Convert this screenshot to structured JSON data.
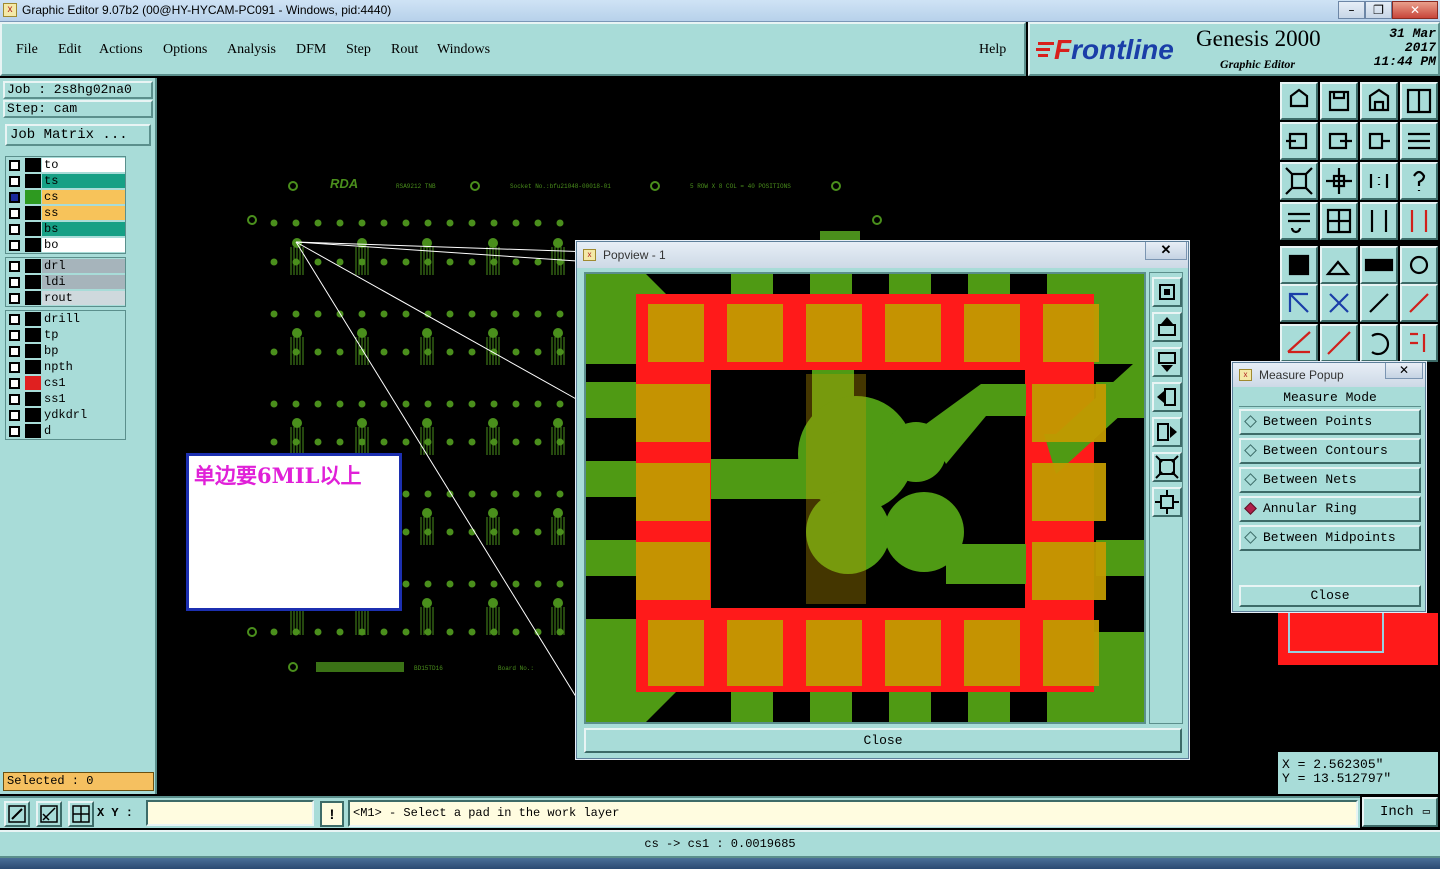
{
  "window": {
    "title": "Graphic Editor 9.07b2 (00@HY-HYCAM-PC091 - Windows, pid:4440)",
    "min": "–",
    "max": "❐",
    "close": "✕",
    "app_icon": "x"
  },
  "menu": [
    {
      "label": "File"
    },
    {
      "label": "Edit"
    },
    {
      "label": "Actions"
    },
    {
      "label": "Options"
    },
    {
      "label": "Analysis"
    },
    {
      "label": "DFM"
    },
    {
      "label": "Step"
    },
    {
      "label": "Rout"
    },
    {
      "label": "Windows"
    }
  ],
  "help": "Help",
  "banner": {
    "brand_f": "F",
    "brand_rest": "rontline",
    "product": "Genesis 2000",
    "subtitle": "Graphic Editor",
    "date": "31 Mar 2017",
    "time": "11:44 PM"
  },
  "job": {
    "job_line": "Job : 2s8hg02na0",
    "step_line": "Step: cam",
    "matrix_button": "Job Matrix ..."
  },
  "layers": {
    "group1": [
      {
        "name": "to",
        "color": "#ffffff",
        "checked": false
      },
      {
        "name": "ts",
        "color": "#16a085",
        "checked": false
      },
      {
        "name": "cs",
        "color": "#f7c35a",
        "checked": true,
        "swatch": "#2e9a20"
      },
      {
        "name": "ss",
        "color": "#f7c35a",
        "checked": false
      },
      {
        "name": "bs",
        "color": "#16a085",
        "checked": false
      },
      {
        "name": "bo",
        "color": "#ffffff",
        "checked": false
      }
    ],
    "group2": [
      {
        "name": "drl",
        "color": "#a6b4bb",
        "checked": false
      },
      {
        "name": "ldi",
        "color": "#a6b4bb",
        "checked": false
      },
      {
        "name": "rout",
        "color": "#cfd9dd",
        "checked": false
      }
    ],
    "group3": [
      {
        "name": "drill",
        "color": "#a8dcd8",
        "checked": false
      },
      {
        "name": "tp",
        "color": "#a8dcd8",
        "checked": false
      },
      {
        "name": "bp",
        "color": "#a8dcd8",
        "checked": false
      },
      {
        "name": "npth",
        "color": "#a8dcd8",
        "checked": false
      },
      {
        "name": "cs1",
        "color": "#a8dcd8",
        "checked": false,
        "swatch": "#e02020"
      },
      {
        "name": "ss1",
        "color": "#a8dcd8",
        "checked": false
      },
      {
        "name": "ydkdrl",
        "color": "#a8dcd8",
        "checked": false
      },
      {
        "name": "d",
        "color": "#a8dcd8",
        "checked": false
      }
    ]
  },
  "selected_text": "Selected : 0",
  "annotation": "单边要6MIL以上",
  "board_texts": {
    "logo": "RDA",
    "t1": "RSA9212 TNB",
    "t2": "Socket No.:bfu21048-00018-01",
    "t3": "5 ROW X 8 COL = 40 POSITIONS",
    "t4": "BD15TD16",
    "t5": "Board No.:"
  },
  "popview": {
    "title": "Popview - 1",
    "close_x": "✕",
    "close_button": "Close"
  },
  "measure": {
    "title": "Measure Popup",
    "close_x": "✕",
    "mode_label": "Measure Mode",
    "options": [
      {
        "label": "Between Points",
        "selected": false
      },
      {
        "label": "Between Contours",
        "selected": false
      },
      {
        "label": "Between Nets",
        "selected": false
      },
      {
        "label": "Annular Ring",
        "selected": true
      },
      {
        "label": "Between Midpoints",
        "selected": false
      }
    ],
    "close_button": "Close"
  },
  "coords": {
    "x": "X  =  2.562305\"",
    "y": "Y  = 13.512797\""
  },
  "cmd": {
    "xy_label": "X Y :",
    "xy_value": "",
    "warn": "!",
    "prompt": "<M1> - Select a pad in the work layer",
    "unit": "Inch"
  },
  "status": "cs -> cs1 : 0.0019685",
  "colors": {
    "panel": "#a8dcd8",
    "copper": "#4f9a14",
    "soldermask": "#ff1a1a",
    "pad": "#c29a00",
    "board_green": "#4a8f1c"
  }
}
